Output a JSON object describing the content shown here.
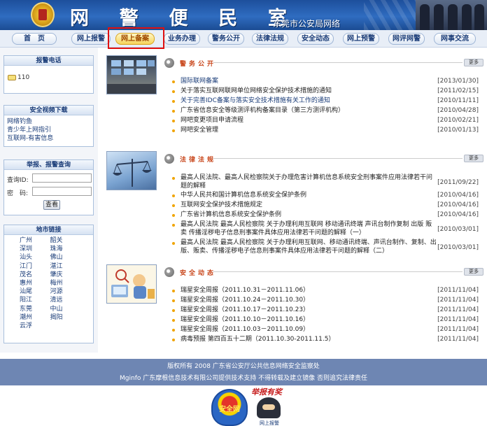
{
  "banner": {
    "title_chars": [
      "网",
      "警",
      "便",
      "民",
      "室"
    ],
    "subtitle": "东莞市公安局网络"
  },
  "nav": {
    "items": [
      "首　页",
      "网上报警",
      "网上备案",
      "业务办理",
      "警务公开",
      "法律法规",
      "安全动态",
      "网上预警",
      "网评网警",
      "网事交流"
    ],
    "active": "网上备案"
  },
  "sidebar": {
    "phone": {
      "title": "报警电话",
      "number": "110"
    },
    "video": {
      "title": "安全视频下载",
      "links": [
        "网络钓鱼",
        "青少年上网指引",
        "互联网-有害信息"
      ]
    },
    "query": {
      "title": "举报、报警查询",
      "id_label": "查询ID:",
      "pwd_label": "密　码:",
      "button": "查看"
    },
    "cities": {
      "title": "地市链接",
      "items": [
        "广州",
        "韶关",
        "深圳",
        "珠海",
        "汕头",
        "佛山",
        "江门",
        "湛江",
        "茂名",
        "肇庆",
        "惠州",
        "梅州",
        "汕尾",
        "河源",
        "阳江",
        "清远",
        "东莞",
        "中山",
        "潮州",
        "揭阳",
        "云浮"
      ]
    }
  },
  "sections": [
    {
      "title": "警务公开",
      "more": "更多",
      "items": [
        {
          "text": "国际联网备案",
          "date": "[2013/01/30]",
          "link": true
        },
        {
          "text": "关于落实互联网联网单位网络安全保护技术措施的通知",
          "date": "[2011/02/15]"
        },
        {
          "text": "关于完善IDC备案与落实安全技术措施有关工作的通知",
          "date": "[2010/11/11]",
          "link": true
        },
        {
          "text": "广东省信息安全等级测评机构备案目录（第三方测评机构）",
          "date": "[2010/04/28]"
        },
        {
          "text": "网吧变更项目申请流程",
          "date": "[2010/02/21]"
        },
        {
          "text": "网吧安全管理",
          "date": "[2010/01/13]"
        }
      ]
    },
    {
      "title": "法律法规",
      "more": "更多",
      "items": [
        {
          "text": "最高人民法院、最高人民检察院关于办理危害计算机信息系统安全刑事案件应用法律若干问题的解释",
          "date": "[2011/09/22]"
        },
        {
          "text": "中华人民共和国计算机信息系统安全保护条例",
          "date": "[2010/04/16]"
        },
        {
          "text": "互联网安全保护技术措施规定",
          "date": "[2010/04/16]"
        },
        {
          "text": "广东省计算机信息系统安全保护条例",
          "date": "[2010/04/16]"
        },
        {
          "text": "最高人民法院 最高人民检察院 关于办理利用互联网 移动通讯终端 声讯台制作复制 出版 贩卖 传播淫秽电子信息刑事案件具体应用法律若干问题的解释（一）",
          "date": "[2010/03/01]"
        },
        {
          "text": "最高人民法院 最高人民检察院 关于办理利用互联网、移动通讯终端、声讯台制作、复制、出版、贩卖、传播淫秽电子信息刑事案件具体应用法律若干问题的解释（二）",
          "date": "[2010/03/01]"
        }
      ]
    },
    {
      "title": "安全动态",
      "more": "更多",
      "items": [
        {
          "text": "瑞星安全周报（2011.10.31－2011.11.06）",
          "date": "[2011/11/04]"
        },
        {
          "text": "瑞星安全周报（2011.10.24－2011.10.30）",
          "date": "[2011/11/04]"
        },
        {
          "text": "瑞星安全周报（2011.10.17－2011.10.23）",
          "date": "[2011/11/04]"
        },
        {
          "text": "瑞星安全周报（2011.10.10－2011.10.16）",
          "date": "[2011/11/04]"
        },
        {
          "text": "瑞星安全周报（2011.10.03－2011.10.09）",
          "date": "[2011/11/04]"
        },
        {
          "text": "病毒预报 第四百五十二期（2011.10.30-2011.11.5）",
          "date": "[2011/11/04]"
        }
      ]
    }
  ],
  "footer": {
    "line1": "版权所有 2008 广东省公安厅公共信息网络安全监察处",
    "line2": "Mginfo 广东摩根信息技术有限公司提供技术支持 不得转载及建立镜像 否则追究法律责任",
    "badge1": "安全网",
    "badge2_title": "举报有奖",
    "badge2_label": "网上报警"
  }
}
